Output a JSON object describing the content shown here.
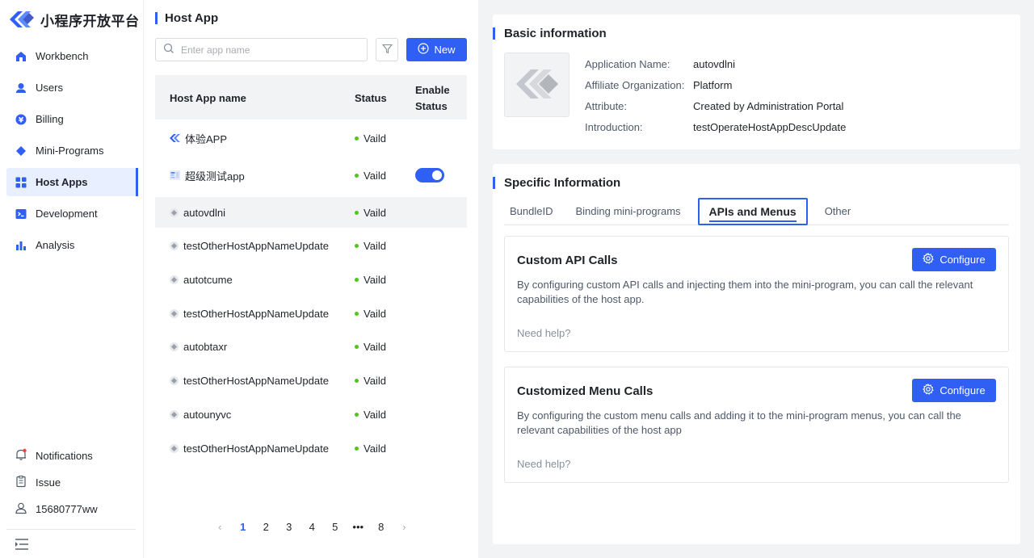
{
  "brand": {
    "name": "小程序开放平台"
  },
  "sidebar": {
    "items": [
      {
        "label": "Workbench",
        "icon": "workbench-icon"
      },
      {
        "label": "Users",
        "icon": "user-icon"
      },
      {
        "label": "Billing",
        "icon": "billing-icon"
      },
      {
        "label": "Mini-Programs",
        "icon": "diamond-icon"
      },
      {
        "label": "Host Apps",
        "icon": "grid-icon",
        "active": true
      },
      {
        "label": "Development",
        "icon": "terminal-icon"
      },
      {
        "label": "Analysis",
        "icon": "bar-chart-icon"
      }
    ],
    "bottom": [
      {
        "label": "Notifications",
        "icon": "bell-icon"
      },
      {
        "label": "Issue",
        "icon": "clipboard-icon"
      },
      {
        "label": "15680777ww",
        "icon": "user-outline-icon"
      }
    ]
  },
  "host_list": {
    "title": "Host App",
    "search_placeholder": "Enter app name",
    "new_label": "New",
    "columns": {
      "name": "Host App name",
      "status": "Status",
      "enable": "Enable Status"
    },
    "rows": [
      {
        "name": "体验APP",
        "status": "Vaild",
        "toggle": false
      },
      {
        "name": "超级测试app",
        "status": "Vaild",
        "toggle": true
      },
      {
        "name": "autovdlni",
        "status": "Vaild",
        "toggle": false
      },
      {
        "name": "testOtherHostAppNameUpdate",
        "status": "Vaild",
        "toggle": false
      },
      {
        "name": "autotcume",
        "status": "Vaild",
        "toggle": false
      },
      {
        "name": "testOtherHostAppNameUpdate",
        "status": "Vaild",
        "toggle": false
      },
      {
        "name": "autobtaxr",
        "status": "Vaild",
        "toggle": false
      },
      {
        "name": "testOtherHostAppNameUpdate",
        "status": "Vaild",
        "toggle": false
      },
      {
        "name": "autounyvc",
        "status": "Vaild",
        "toggle": false
      },
      {
        "name": "testOtherHostAppNameUpdate",
        "status": "Vaild",
        "toggle": false
      }
    ],
    "pagination": {
      "pages": [
        "1",
        "2",
        "3",
        "4",
        "5",
        "•••",
        "8"
      ],
      "current": "1"
    }
  },
  "basic": {
    "title": "Basic information",
    "fields": [
      {
        "k": "Application Name:",
        "v": "autovdlni"
      },
      {
        "k": "Affiliate Organization:",
        "v": "Platform"
      },
      {
        "k": "Attribute:",
        "v": "Created by Administration Portal"
      },
      {
        "k": "Introduction:",
        "v": "testOperateHostAppDescUpdate"
      }
    ]
  },
  "specific": {
    "title": "Specific Information",
    "tabs": [
      "BundleID",
      "Binding mini-programs",
      "APIs and Menus",
      "Other"
    ],
    "active_tab": "APIs and Menus",
    "sections": [
      {
        "title": "Custom API Calls",
        "button": "Configure",
        "desc": "By configuring custom API calls and injecting them into the mini-program, you can call the relevant capabilities of the host app.",
        "help": "Need help?"
      },
      {
        "title": "Customized Menu Calls",
        "button": "Configure",
        "desc": "By configuring the custom menu calls and adding it to the mini-program menus, you can call the relevant capabilities of the host app",
        "help": "Need help?"
      }
    ]
  },
  "colors": {
    "accent": "#2f5ff3",
    "valid": "#52c41a",
    "active_bg": "#e8efff"
  }
}
